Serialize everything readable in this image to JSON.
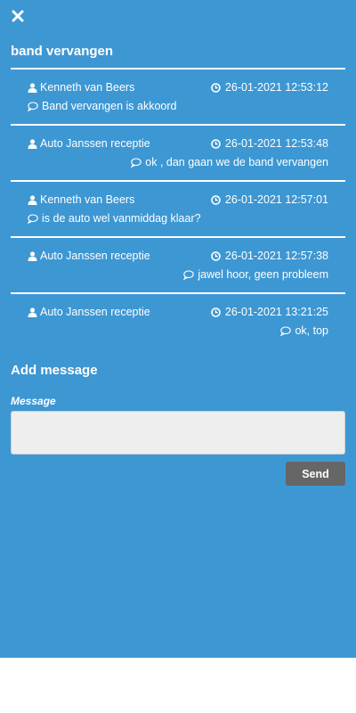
{
  "header": {
    "close_icon": "close-icon",
    "title": "band vervangen"
  },
  "messages": [
    {
      "author": "Kenneth van Beers",
      "time": "26-01-2021 12:53:12",
      "text": "Band vervangen is akkoord",
      "align": "left"
    },
    {
      "author": "Auto Janssen receptie",
      "time": "26-01-2021 12:53:48",
      "text": "ok , dan gaan we de band vervangen",
      "align": "right"
    },
    {
      "author": "Kenneth van Beers",
      "time": "26-01-2021 12:57:01",
      "text": "is de auto wel vanmiddag klaar?",
      "align": "left"
    },
    {
      "author": "Auto Janssen receptie",
      "time": "26-01-2021 12:57:38",
      "text": "jawel hoor, geen probleem",
      "align": "right"
    },
    {
      "author": "Auto Janssen receptie",
      "time": "26-01-2021 13:21:25",
      "text": "ok, top",
      "align": "right"
    }
  ],
  "form": {
    "heading": "Add message",
    "message_label": "Message",
    "message_value": "",
    "send_label": "Send"
  },
  "icons": {
    "author": "user-icon",
    "time": "clock-icon",
    "text": "speech-bubble-icon"
  },
  "colors": {
    "panel_bg": "#3d97d3",
    "send_button_bg": "#666666",
    "input_bg": "#eeeeee"
  }
}
